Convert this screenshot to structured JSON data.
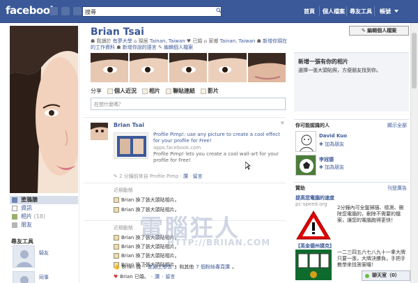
{
  "topbar": {
    "logo": "facebook",
    "search_value": "搜尋",
    "nav": [
      "首頁",
      "個人檔案",
      "尋友工具",
      "帳號"
    ]
  },
  "profile": {
    "name": "Brian Tsai",
    "edit_button": "編輯個人檔案",
    "info_line1_a": "我讀於",
    "info_line1_school": "有夢大學",
    "info_line1_b": "現居",
    "info_line1_city": "Tainan, Taiwan",
    "info_line1_c": "已婚",
    "info_line1_d": "家鄉",
    "info_line1_home": "Tainan, Taiwan",
    "info_line1_e": "新增你現在",
    "info_line2_a": "的工作資料",
    "info_line2_b": "新增你說的語言",
    "info_line2_c": "編輯個人檔案"
  },
  "share": {
    "label": "分享",
    "options": [
      "個人近況",
      "相片",
      "聯貼連結",
      "影片"
    ],
    "placeholder": "在想什麼嗎？"
  },
  "left_menu": {
    "items": [
      "塗鴉牆",
      "資訊",
      "相片",
      "朋友"
    ],
    "photos_count": "(18)",
    "section": "尋友工具",
    "friends": [
      "騎友",
      "同事"
    ]
  },
  "post": {
    "author": "Brian Tsai",
    "title": "Profile Pimp!: use any picture to create a cool effect for your profile for Free!",
    "url": "apps.facebook.com",
    "desc": "Profile Pimp! lets you create a cool wall-art for your profile for Free!",
    "meta_time": "2 分鐘前來自 Profile Pimp",
    "meta_like": "讚",
    "meta_comment": "留言"
  },
  "recent1": {
    "title": "近期動態",
    "items": [
      "Brian 換了張大頭貼相片。",
      "Brian 換了張大頭貼相片。"
    ]
  },
  "recent2": {
    "title": "近期動態",
    "items": [
      "Brian 換了張大頭貼相片。",
      "Brian 換了張大頭貼相片。",
      "Brian 換了張大頭貼相片。",
      "Brian 換了張大頭貼相片。"
    ],
    "liked_a": "Brian 說「",
    "liked_link": "走路上學去",
    "liked_b": "」和其他",
    "liked_link2": "7 個粉絲專頁讚",
    "liked_c": "。",
    "last": "Brian 已婚。",
    "last_like": "讚",
    "last_comment": "留言"
  },
  "watermark": {
    "main": "電腦狂人",
    "sub": "HTTP://BRIIAN.COM"
  },
  "right": {
    "add_photo_title": "新增一張有你的相片",
    "add_photo_desc": "選擇一張大頭貼照，方便朋友找到你。",
    "pymk_title": "你可能認識的人",
    "pymk_all": "顯示全部",
    "pymk": [
      {
        "name": "David Kuo",
        "add": "加為朋友"
      },
      {
        "name": "李冠德",
        "add": "加為朋友"
      }
    ],
    "ads_title": "贊助",
    "ads_create": "刊登廣告",
    "ad1_title": "提高您電腦的速度",
    "ad1_url": "pc-speed.org",
    "ad1_text": "2分鐘內可全盤掃描、檢測、刪除您電腦的，刪除不需要的檔案，讓您的電腦跑得更快！",
    "ad2_title": "【英金德州撲克】",
    "ad2_text": "一二三四五六七八九十一拿大牌只要一張，大牌決勝負，手把手教學來找答案囉！",
    "chat": "聊天室（0）"
  },
  "colors": {
    "brand": "#3b5998",
    "link": "#3b5998",
    "bar": "#3b5998"
  }
}
